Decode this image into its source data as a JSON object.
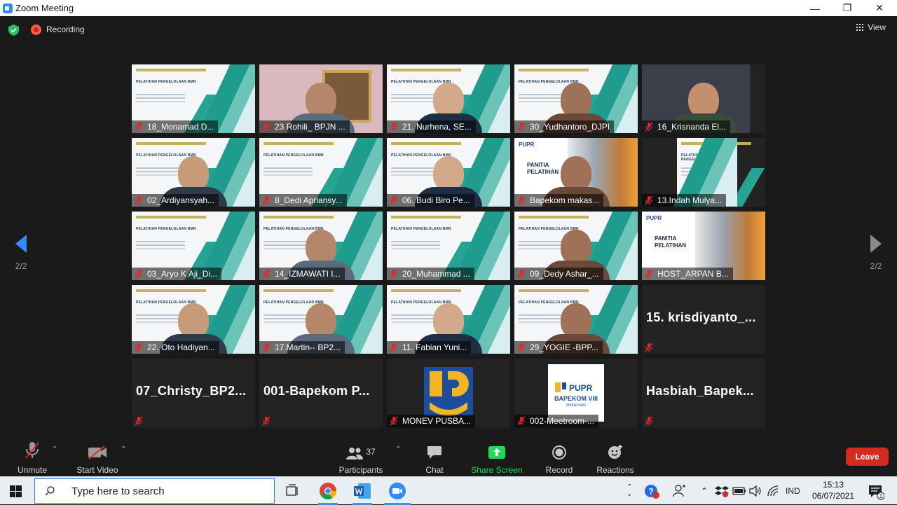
{
  "window": {
    "title": "Zoom Meeting",
    "minimize": "—",
    "maximize": "❐",
    "close": "✕"
  },
  "topbar": {
    "recording_label": "Recording",
    "view_label": "View"
  },
  "pager": {
    "left_label": "2/2",
    "right_label": "2/2"
  },
  "tiles": [
    {
      "name": "18_Monamad D...",
      "kind": "slide",
      "person": false
    },
    {
      "name": "23 Rohili_ BPJN ...",
      "kind": "room",
      "person": true
    },
    {
      "name": "21. Nurhena, SE...",
      "kind": "slide",
      "person": true
    },
    {
      "name": "30_Yudhantoro_DJPI",
      "kind": "slide",
      "person": true
    },
    {
      "name": "16_Krisnanda El...",
      "kind": "dark",
      "person": true
    },
    {
      "name": "02_Ardiyansyah...",
      "kind": "slide",
      "person": true
    },
    {
      "name": "8_Dedi Apriansy...",
      "kind": "slide",
      "person": false
    },
    {
      "name": "06. Budi Biro Pe...",
      "kind": "slide",
      "person": true
    },
    {
      "name": "Bapekom makas...",
      "kind": "panitia",
      "person": true
    },
    {
      "name": "13.Indah Mulya...",
      "kind": "slide-narrow",
      "person": false
    },
    {
      "name": "03_Aryo K Aji_Di...",
      "kind": "slide",
      "person": false
    },
    {
      "name": "14_IZMAWATI I...",
      "kind": "slide",
      "person": true
    },
    {
      "name": "20_Muhammad ...",
      "kind": "slide",
      "person": false
    },
    {
      "name": "09_Dedy Ashar_...",
      "kind": "slide",
      "person": true
    },
    {
      "name": "HOST_ARPAN B...",
      "kind": "panitia",
      "person": false
    },
    {
      "name": "22. Oto Hadiyan...",
      "kind": "slide",
      "person": true
    },
    {
      "name": "17.Martin-- BP2...",
      "kind": "slide",
      "person": true
    },
    {
      "name": "11. Fabian Yuni...",
      "kind": "slide",
      "person": true
    },
    {
      "name": "29_YOGIE -BPP...",
      "kind": "slide",
      "person": true
    },
    {
      "name": "",
      "bigname": "15.  krisdiyanto_...",
      "kind": "plain",
      "person": false
    },
    {
      "name": "",
      "bigname": "07_Christy_BP2...",
      "kind": "plain",
      "person": false
    },
    {
      "name": "",
      "bigname": "001-Bapekom  P...",
      "kind": "plain",
      "person": false
    },
    {
      "name": "MONEV PUSBA...",
      "kind": "pupr",
      "person": false
    },
    {
      "name": "002-Meetroom-...",
      "kind": "bapekom",
      "person": false
    },
    {
      "name": "",
      "bigname": "Hasbiah_Bapek...",
      "kind": "plain",
      "person": false
    }
  ],
  "slide_text": {
    "title": "PELATIHAN PENGELOLAAN BMN",
    "panitia": "PANITIA\nPELATIHAN",
    "panitia_brand": "PUPR",
    "bapekom_brand": "PUPR",
    "bapekom_sub": "BAPEKOM VIII",
    "bapekom_city": "MAKASSAR"
  },
  "toolbar": {
    "unmute": "Unmute",
    "start_video": "Start Video",
    "participants": "Participants",
    "participants_count": "37",
    "chat": "Chat",
    "share_screen": "Share Screen",
    "record": "Record",
    "reactions": "Reactions",
    "leave": "Leave"
  },
  "taskbar": {
    "search_placeholder": "Type here to search",
    "language": "IND",
    "time": "15:13",
    "date": "06/07/2021",
    "notification_count": "1"
  },
  "colors": {
    "accent_blue": "#2d8cff",
    "share_green": "#23d959",
    "leave_red": "#d52b1e",
    "recording_red": "#ff5b49",
    "mic_off_red": "#e02828"
  }
}
